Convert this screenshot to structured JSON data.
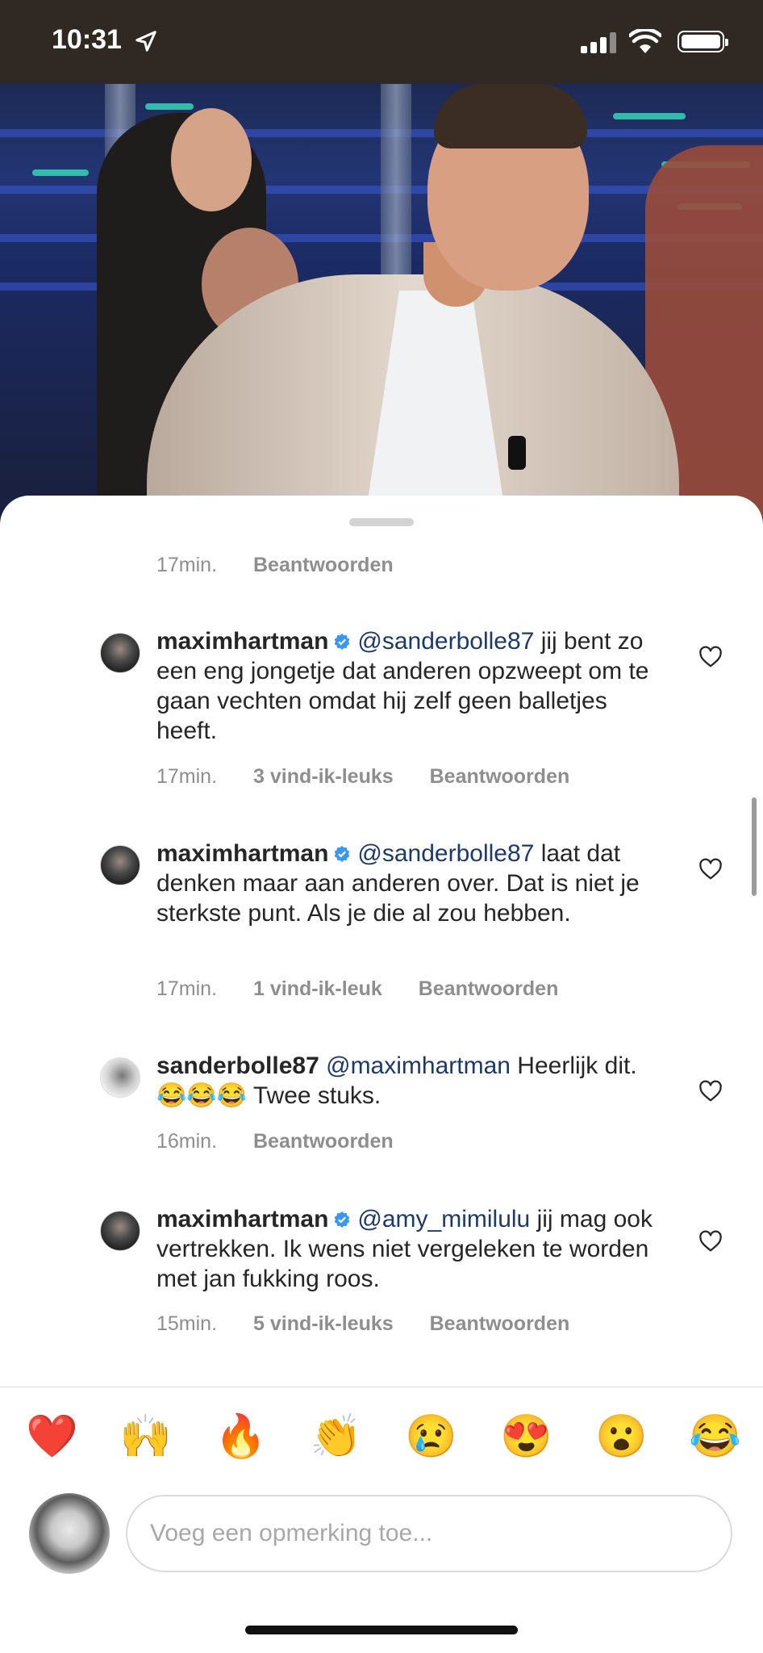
{
  "status_bar": {
    "time": "10:31"
  },
  "comments": [
    {
      "top_meta": {
        "time": "17min.",
        "reply": "Beantwoorden"
      }
    },
    {
      "username": "maximhartman",
      "mention": "@sanderbolle87",
      "text": " jij bent zo een eng jongetje dat anderen opzweept om te gaan vechten omdat hij zelf geen balletjes heeft.",
      "time": "17min.",
      "likes": "3 vind-ik-leuks",
      "reply": "Beantwoorden"
    },
    {
      "username": "maximhartman",
      "mention": "@sanderbolle87",
      "text": " laat dat denken maar aan anderen over. Dat is niet je sterkste punt. Als je die al zou hebben.",
      "time": "17min.",
      "likes": "1 vind-ik-leuk",
      "reply": "Beantwoorden"
    },
    {
      "username": "sanderbolle87",
      "mention": "@maximhartman",
      "text": " Heerlijk dit. 😂😂😂 Twee stuks.",
      "time": "16min.",
      "reply": "Beantwoorden"
    },
    {
      "username": "maximhartman",
      "mention": "@amy_mimilulu",
      "text": " jij mag ook vertrekken. Ik wens niet vergeleken te worden met jan fukking roos.",
      "time": "15min.",
      "likes": "5 vind-ik-leuks",
      "reply": "Beantwoorden"
    }
  ],
  "emoji_bar": [
    "❤️",
    "🙌",
    "🔥",
    "👏",
    "😢",
    "😍",
    "😮",
    "😂"
  ],
  "comment_input": {
    "placeholder": "Voeg een opmerking toe..."
  }
}
